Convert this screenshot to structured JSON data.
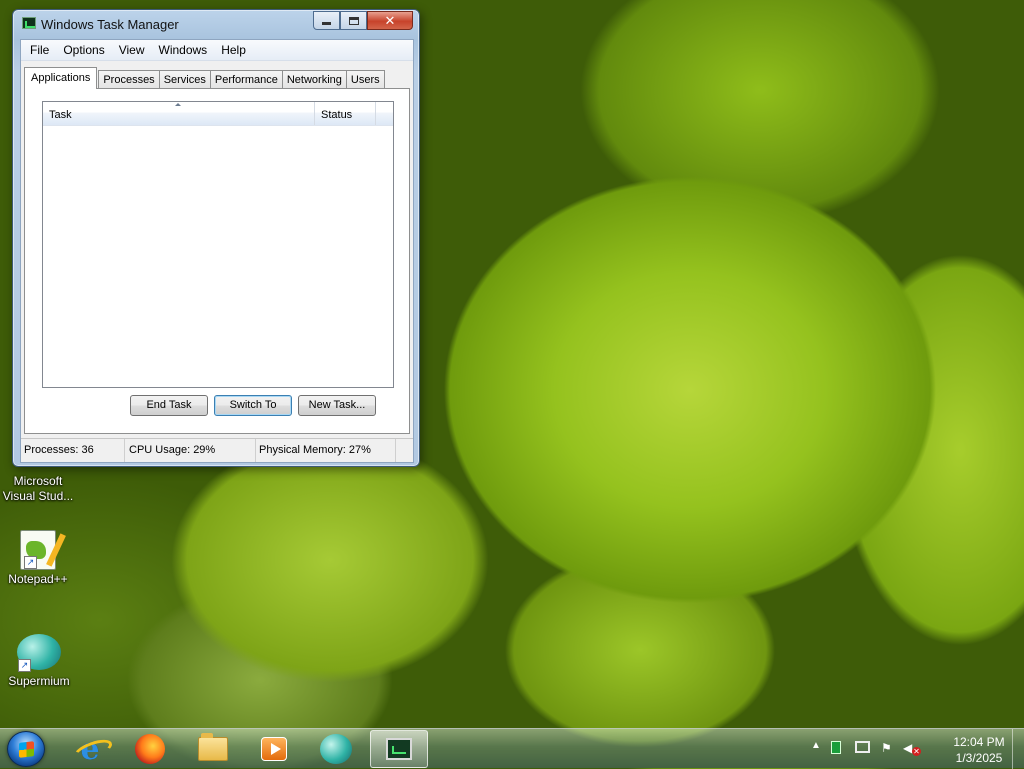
{
  "window": {
    "title": "Windows Task Manager",
    "menu": [
      "File",
      "Options",
      "View",
      "Windows",
      "Help"
    ],
    "tabs": [
      "Applications",
      "Processes",
      "Services",
      "Performance",
      "Networking",
      "Users"
    ],
    "active_tab": "Applications",
    "columns": {
      "task": "Task",
      "status": "Status"
    },
    "rows": [],
    "buttons": {
      "end_task": "End Task",
      "switch_to": "Switch To",
      "new_task": "New Task..."
    },
    "status": {
      "processes": "Processes: 36",
      "cpu": "CPU Usage: 29%",
      "memory": "Physical Memory: 27%"
    },
    "close_glyph": "✕"
  },
  "desktop_icons": [
    {
      "label": "Microsoft Visual Stud...",
      "icon": "visual-studio-icon"
    },
    {
      "label": "Notepad++",
      "icon": "notepad-plus-plus-icon"
    },
    {
      "label": "Supermium",
      "icon": "supermium-icon"
    }
  ],
  "taskbar": {
    "pinned": [
      "internet-explorer-icon",
      "firefox-icon",
      "file-explorer-icon",
      "media-player-icon",
      "supermium-icon",
      "task-manager-icon"
    ],
    "active": "task-manager-icon",
    "clock": {
      "time": "12:04 PM",
      "date": "1/3/2025"
    },
    "tray_arrow": "▲"
  }
}
